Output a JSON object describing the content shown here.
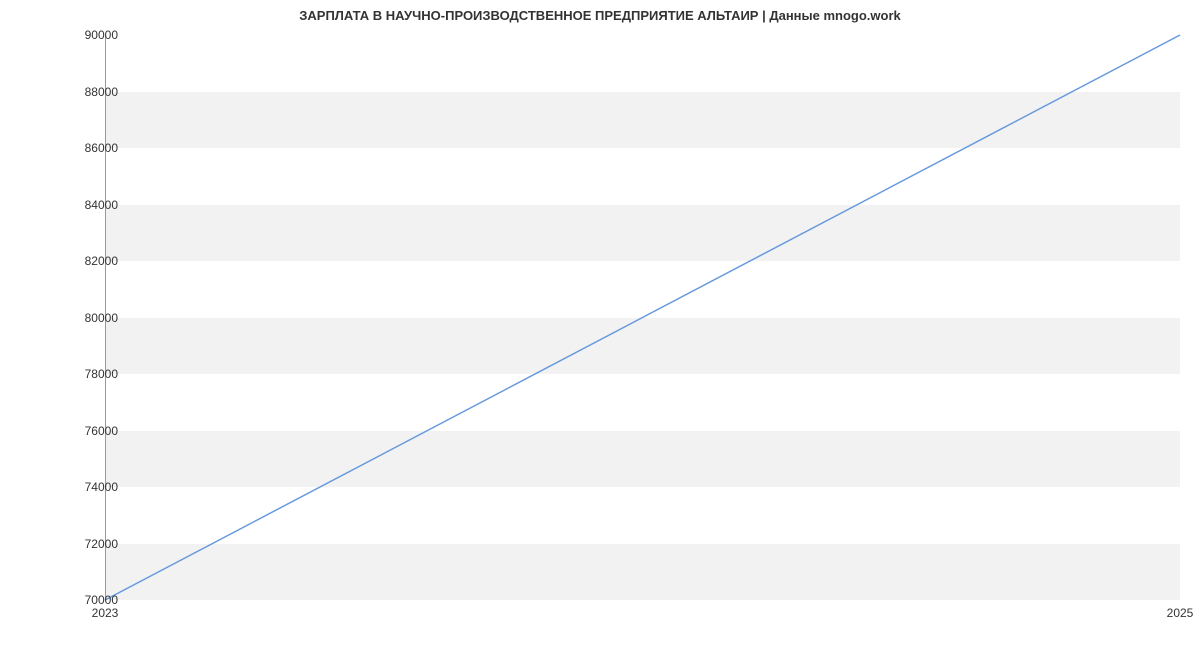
{
  "chart_data": {
    "type": "line",
    "title": "ЗАРПЛАТА В  НАУЧНО-ПРОИЗВОДСТВЕННОЕ ПРЕДПРИЯТИЕ АЛЬТАИР | Данные mnogo.work",
    "xlabel": "",
    "ylabel": "",
    "x": [
      2023,
      2025
    ],
    "x_ticks": [
      "2023",
      "2025"
    ],
    "values": [
      70000,
      90000
    ],
    "y_ticks": [
      70000,
      72000,
      74000,
      76000,
      78000,
      80000,
      82000,
      84000,
      86000,
      88000,
      90000
    ],
    "ylim": [
      70000,
      90000
    ],
    "xlim": [
      2023,
      2025
    ],
    "line_color": "#6699dd",
    "grid": true
  }
}
